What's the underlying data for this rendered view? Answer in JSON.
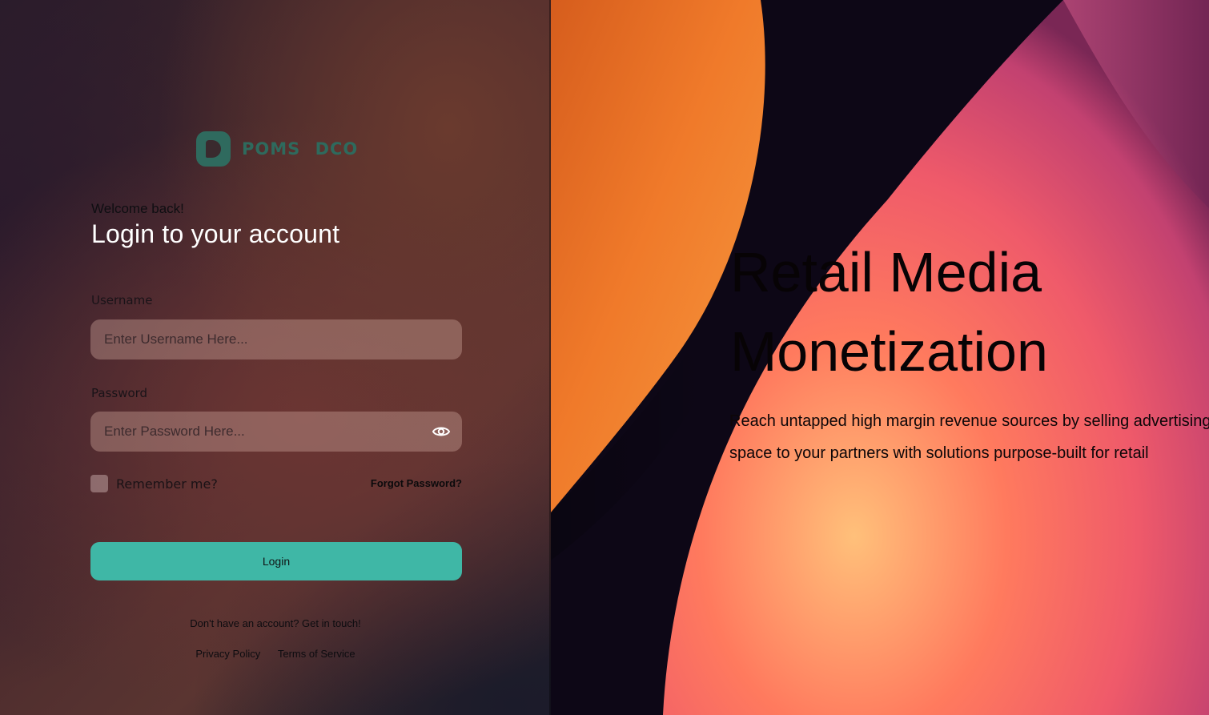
{
  "brand": {
    "name": "POMS DCO",
    "logo_icon": "poms-logo-icon",
    "accent_color": "#3fb7a6"
  },
  "login": {
    "welcome_text": "Welcome back!",
    "title": "Login to your account",
    "username_label": "Username",
    "username_placeholder": "Enter Username Here...",
    "username_value": "",
    "password_label": "Password",
    "password_placeholder": "Enter Password Here...",
    "password_value": "",
    "password_toggle_icon": "eye-icon",
    "remember_label": "Remember me?",
    "remember_checked": false,
    "forgot_password": "Forgot Password?",
    "login_button": "Login",
    "signup_note": "Don't have an account? Get in touch!"
  },
  "footer": {
    "privacy": "Privacy Policy",
    "terms": "Terms of Service"
  },
  "hero": {
    "title_line1": "Retail Media",
    "title_line2": "Monetization",
    "subtitle_line1": "Reach untapped high margin revenue sources by selling advertising",
    "subtitle_line2": "space to your partners with solutions purpose-built for retail"
  }
}
